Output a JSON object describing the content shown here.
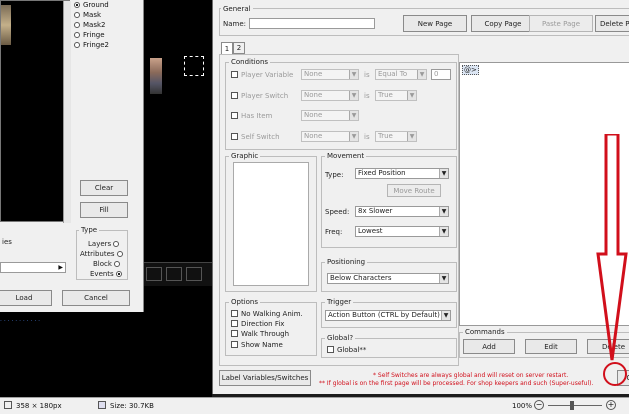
{
  "left_panel": {
    "layers": [
      "Ground",
      "Mask",
      "Mask2",
      "Fringe",
      "Fringe2"
    ],
    "clear_label": "Clear",
    "fill_label": "Fill",
    "type_title": "Type",
    "types": [
      "Layers",
      "Attributes",
      "Block",
      "Events"
    ],
    "partial_label": "ies",
    "load_label": "Load",
    "cancel_label": "Cancel"
  },
  "general": {
    "title": "General",
    "name_label": "Name:",
    "name_value": "",
    "new_page": "New Page",
    "copy_page": "Copy Page",
    "paste_page": "Paste Page",
    "delete_page": "Delete Pa"
  },
  "tabs": [
    "1",
    "2"
  ],
  "conditions": {
    "title": "Conditions",
    "player_variable": "Player Variable",
    "player_switch": "Player Switch",
    "has_item": "Has Item",
    "self_switch": "Self Switch",
    "none": "None",
    "is": "is",
    "equal_to": "Equal To",
    "equal_value": "0",
    "true_val": "True"
  },
  "graphic": {
    "title": "Graphic"
  },
  "movement": {
    "title": "Movement",
    "type_label": "Type:",
    "type_value": "Fixed Position",
    "move_route": "Move Route",
    "speed_label": "Speed:",
    "speed_value": "8x Slower",
    "freq_label": "Freq:",
    "freq_value": "Lowest"
  },
  "positioning": {
    "title": "Positioning",
    "value": "Below Characters"
  },
  "options": {
    "title": "Options",
    "items": [
      "No Walking Anim.",
      "Direction Fix",
      "Walk Through",
      "Show Name"
    ]
  },
  "trigger": {
    "title": "Trigger",
    "value": "Action Button (CTRL by Default)"
  },
  "global": {
    "title": "Global?",
    "label": "Global**"
  },
  "commands": {
    "first_line": "@>",
    "title": "Commands",
    "add": "Add",
    "edit": "Edit",
    "delete": "Delete"
  },
  "footer": {
    "labels_button": "Label Variables/Switches",
    "note1": "* Self Switches are always global and will reset on server restart.",
    "note2": "** If global is on the first page will be processed. For shop keepers and such (Super-useful).",
    "ok": "O"
  },
  "statusbar": {
    "dimensions": "358 × 180px",
    "size": "Size: 30.7KB",
    "zoom": "100%"
  },
  "colors": {
    "annotation_red": "#d10f1b"
  }
}
